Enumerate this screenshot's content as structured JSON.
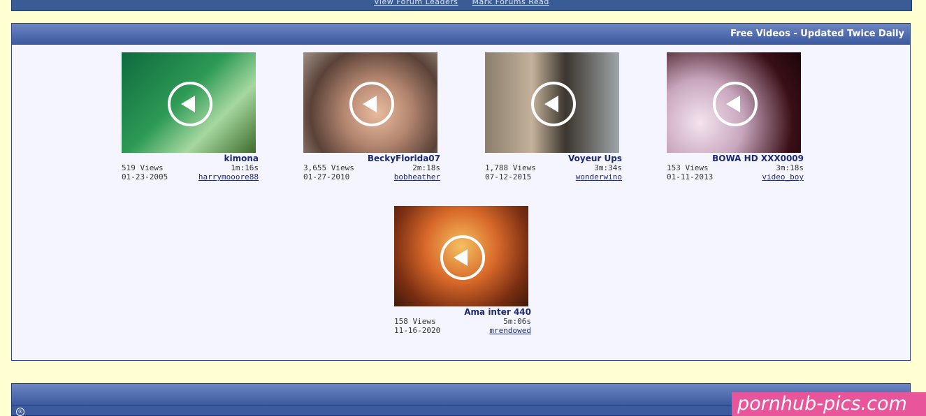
{
  "nav": {
    "link_leaders": "View Forum Leaders",
    "link_mark_read": "Mark Forums Read"
  },
  "section": {
    "title": "Free Videos - Updated Twice Daily"
  },
  "videos": [
    {
      "title": "kimona",
      "duration": "1m:16s",
      "views": "519 Views",
      "user": "harrymooore88",
      "date": "01-23-2005"
    },
    {
      "title": "BeckyFlorida07",
      "duration": "2m:18s",
      "views": "3,655 Views",
      "user": "bobheather",
      "date": "01-27-2010"
    },
    {
      "title": "Voyeur Ups",
      "duration": "3m:34s",
      "views": "1,788 Views",
      "user": "wonderwino",
      "date": "07-12-2015"
    },
    {
      "title": "BOWA HD XXX0009",
      "duration": "3m:18s",
      "views": "153 Views",
      "user": "video_boy",
      "date": "01-11-2013"
    },
    {
      "title": "Ama inter 440",
      "duration": "5m:06s",
      "views": "158 Views",
      "user": "mrendowed",
      "date": "11-16-2020"
    }
  ],
  "watermark": "pornhub-pics.com",
  "footer_icon": "registered-icon"
}
